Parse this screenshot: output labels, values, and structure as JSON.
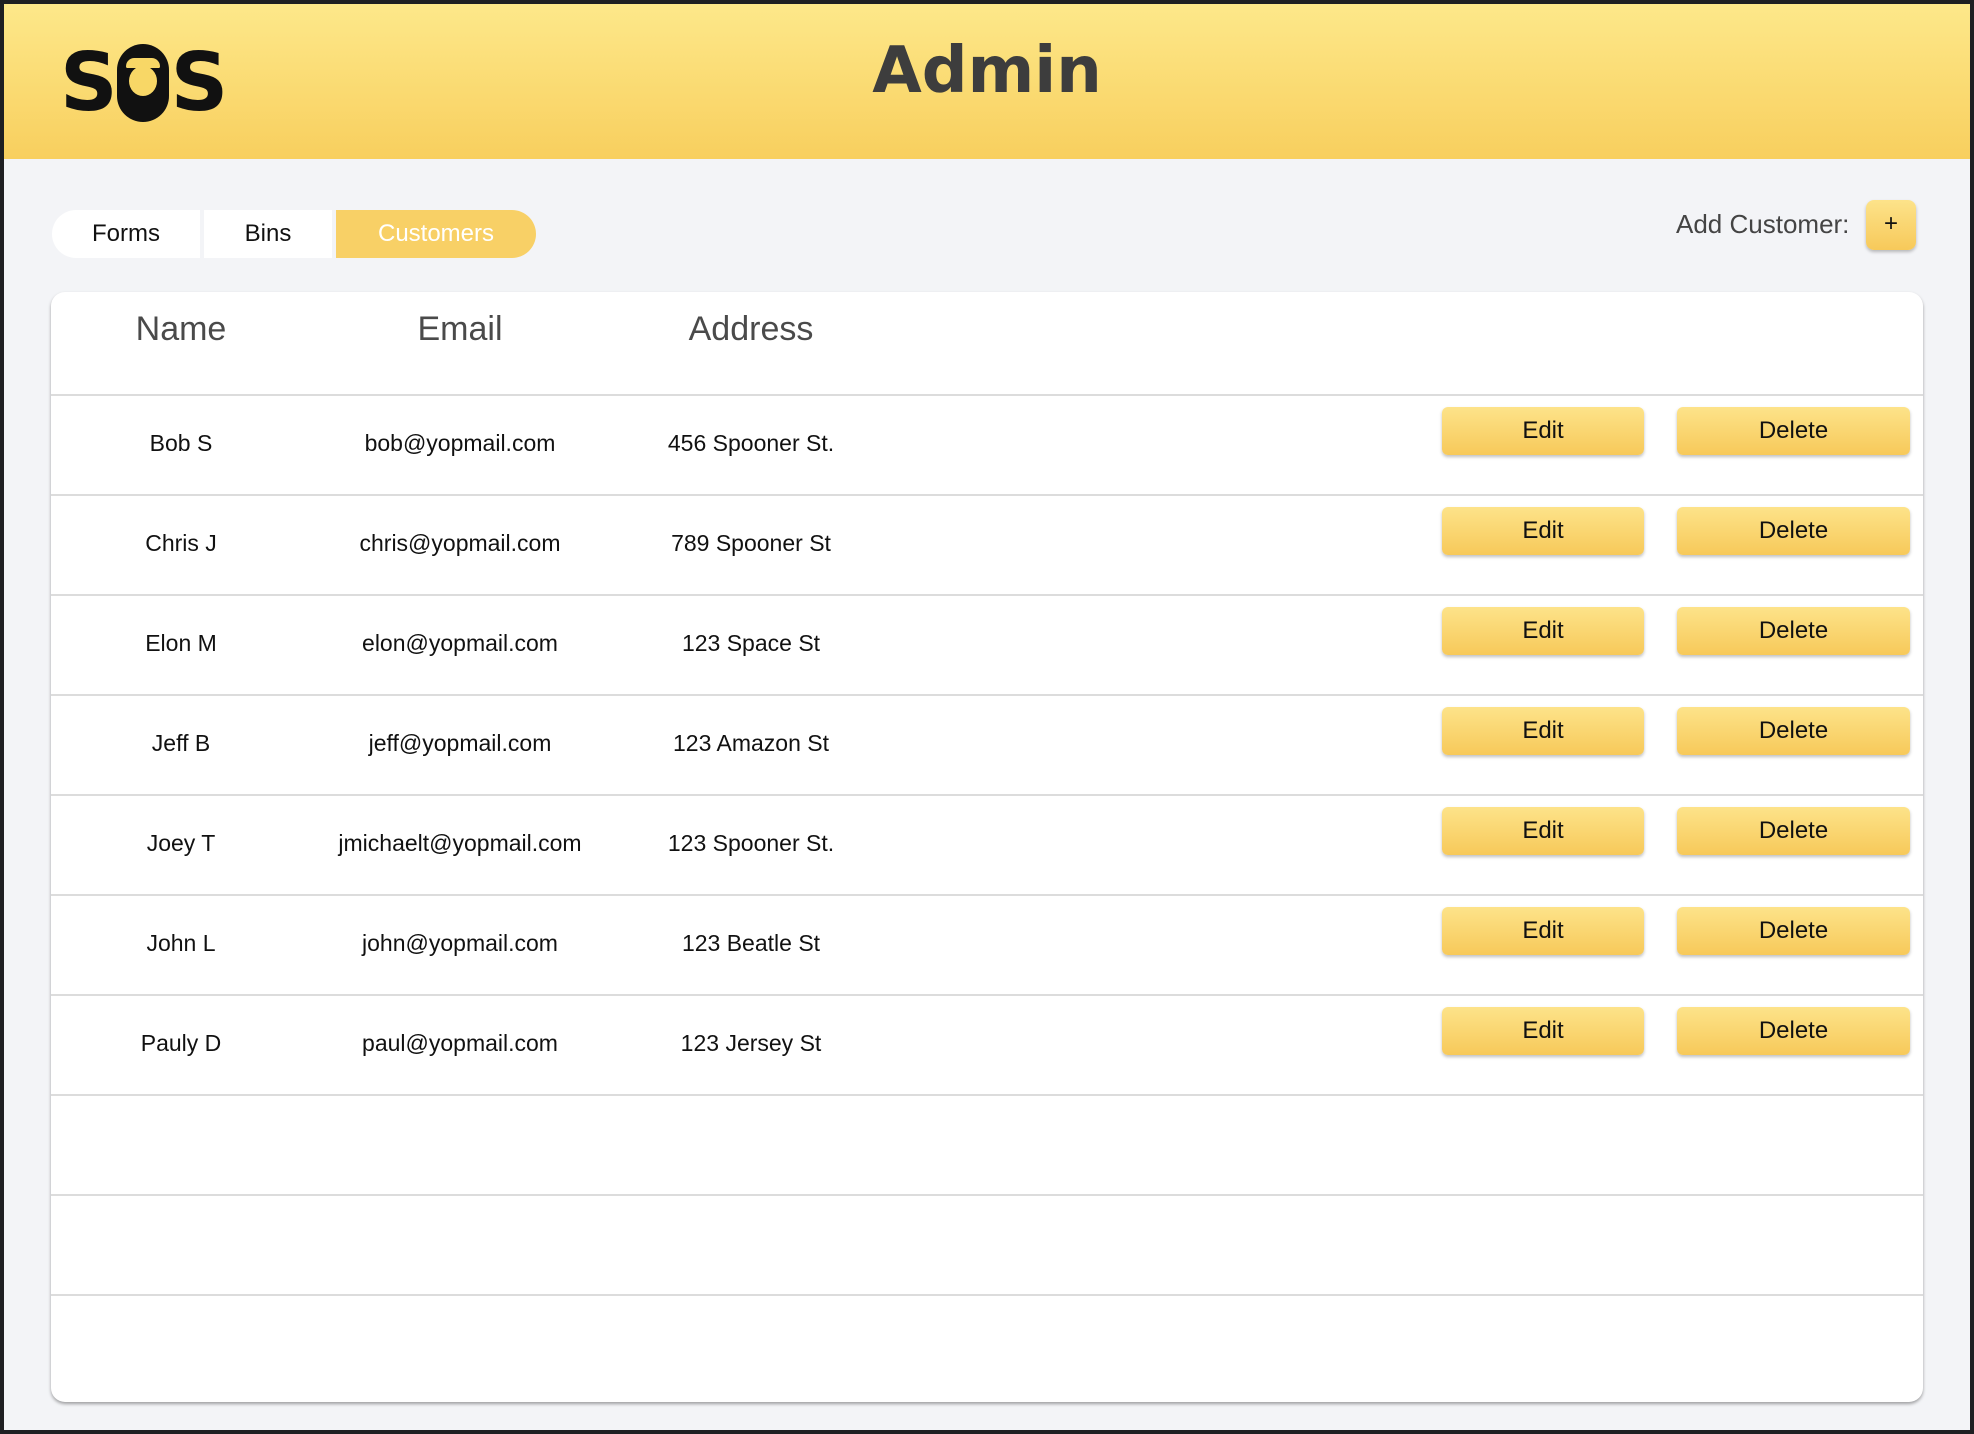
{
  "header": {
    "logo_text": {
      "left": "S",
      "right": "S"
    },
    "title": "Admin"
  },
  "tabs": [
    {
      "label": "Forms",
      "active": false
    },
    {
      "label": "Bins",
      "active": false
    },
    {
      "label": "Customers",
      "active": true
    }
  ],
  "add_customer": {
    "label": "Add Customer:",
    "button_label": "+"
  },
  "table": {
    "headers": {
      "name": "Name",
      "email": "Email",
      "address": "Address"
    },
    "rows": [
      {
        "name": "Bob S",
        "email": "bob@yopmail.com",
        "address": "456 Spooner St.",
        "edit_label": "Edit",
        "delete_label": "Delete"
      },
      {
        "name": "Chris J",
        "email": "chris@yopmail.com",
        "address": "789 Spooner St",
        "edit_label": "Edit",
        "delete_label": "Delete"
      },
      {
        "name": "Elon M",
        "email": "elon@yopmail.com",
        "address": "123 Space St",
        "edit_label": "Edit",
        "delete_label": "Delete"
      },
      {
        "name": "Jeff B",
        "email": "jeff@yopmail.com",
        "address": "123 Amazon St",
        "edit_label": "Edit",
        "delete_label": "Delete"
      },
      {
        "name": "Joey T",
        "email": "jmichaelt@yopmail.com",
        "address": "123 Spooner St.",
        "edit_label": "Edit",
        "delete_label": "Delete"
      },
      {
        "name": "John L",
        "email": "john@yopmail.com",
        "address": "123 Beatle St",
        "edit_label": "Edit",
        "delete_label": "Delete"
      },
      {
        "name": "Pauly D",
        "email": "paul@yopmail.com",
        "address": "123 Jersey St",
        "edit_label": "Edit",
        "delete_label": "Delete"
      }
    ]
  },
  "colors": {
    "accent": "#f8d066",
    "header_top": "#fde88a",
    "header_bottom": "#f8cf5e",
    "background": "#f3f4f7"
  }
}
